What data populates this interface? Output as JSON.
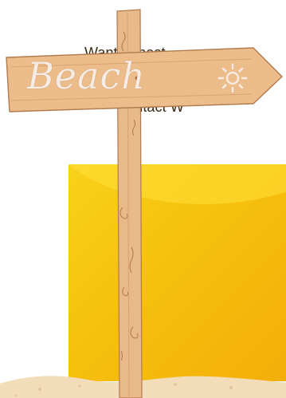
{
  "sign": {
    "label": "Beach",
    "icon": "sun-icon"
  },
  "card": {
    "line1": "Want to host",
    "line2": "Contact W"
  },
  "colors": {
    "card_yellow": "#f6c20c",
    "wood": "#e8b98a",
    "wood_dark": "#b07a4e",
    "sand": "#f3dcb8",
    "sign_text": "#f6ece4"
  }
}
